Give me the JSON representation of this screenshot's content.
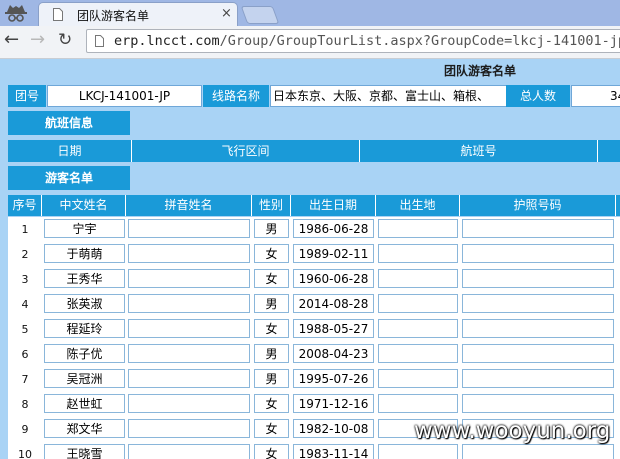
{
  "browser": {
    "tab_title": "团队游客名单",
    "tab_close": "×",
    "url_host": "erp.lncct.com",
    "url_path": "/Group/GroupTourList.aspx?GroupCode=lkcj-141001-jp"
  },
  "page": {
    "title": "团队游客名单",
    "group_label": "团号",
    "group_value": "LKCJ-141001-JP",
    "route_label": "线路名称",
    "route_value": "日本东京、大阪、京都、富士山、箱根、",
    "total_label": "总人数",
    "total_value": "34"
  },
  "flight_section": {
    "label": "航班信息",
    "columns": [
      "日期",
      "飞行区间",
      "航班号"
    ]
  },
  "tourist_section": {
    "label": "游客名单",
    "columns": [
      "序号",
      "中文姓名",
      "拼音姓名",
      "性别",
      "出生日期",
      "出生地",
      "护照号码"
    ],
    "rows": [
      {
        "no": "1",
        "name": "宁宇",
        "pinyin": "",
        "gender": "男",
        "birth": "1986-06-28",
        "place": "",
        "passport": ""
      },
      {
        "no": "2",
        "name": "于萌萌",
        "pinyin": "",
        "gender": "女",
        "birth": "1989-02-11",
        "place": "",
        "passport": ""
      },
      {
        "no": "3",
        "name": "王秀华",
        "pinyin": "",
        "gender": "女",
        "birth": "1960-06-28",
        "place": "",
        "passport": ""
      },
      {
        "no": "4",
        "name": "张英淑",
        "pinyin": "",
        "gender": "男",
        "birth": "2014-08-28",
        "place": "",
        "passport": ""
      },
      {
        "no": "5",
        "name": "程延玲",
        "pinyin": "",
        "gender": "女",
        "birth": "1988-05-27",
        "place": "",
        "passport": ""
      },
      {
        "no": "6",
        "name": "陈子优",
        "pinyin": "",
        "gender": "男",
        "birth": "2008-04-23",
        "place": "",
        "passport": ""
      },
      {
        "no": "7",
        "name": "吴冠洲",
        "pinyin": "",
        "gender": "男",
        "birth": "1995-07-26",
        "place": "",
        "passport": ""
      },
      {
        "no": "8",
        "name": "赵世虹",
        "pinyin": "",
        "gender": "女",
        "birth": "1971-12-16",
        "place": "",
        "passport": ""
      },
      {
        "no": "9",
        "name": "郑文华",
        "pinyin": "",
        "gender": "女",
        "birth": "1982-10-08",
        "place": "",
        "passport": ""
      },
      {
        "no": "10",
        "name": "王晓雪",
        "pinyin": "",
        "gender": "女",
        "birth": "1983-11-14",
        "place": "",
        "passport": ""
      }
    ]
  },
  "watermark": "www.wooyun.org",
  "colors": {
    "header_blue": "#1a9ad8",
    "page_bg": "#a9d3f5",
    "tabstrip": "#9fb7e4"
  }
}
